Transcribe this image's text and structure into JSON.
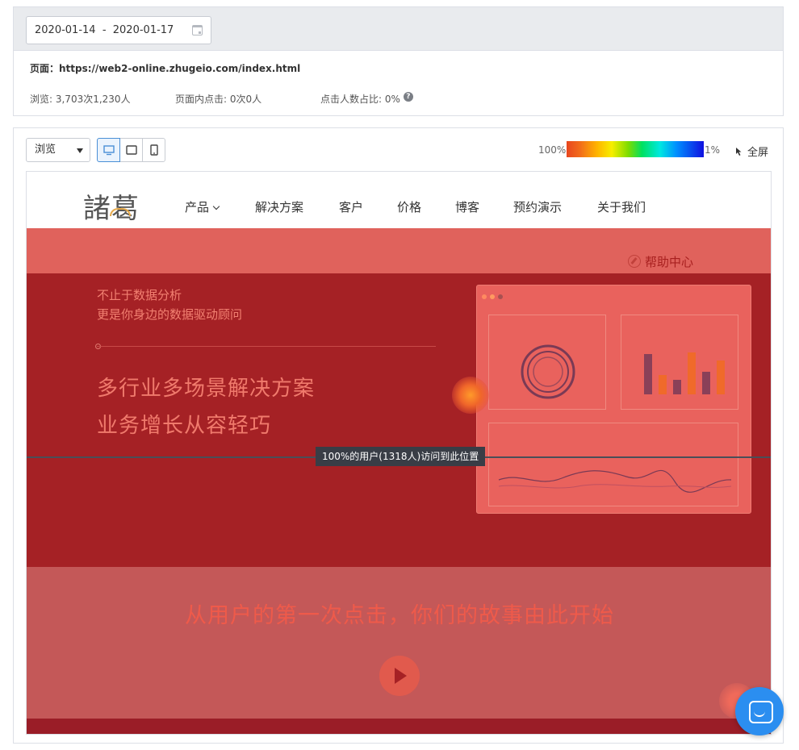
{
  "filter": {
    "date_range": "2020-01-14  -  2020-01-17",
    "page_label": "页面：https://web2-online.zhugeio.com/index.html",
    "stats": {
      "views": "浏览: 3,703次1,230人",
      "in_page_clicks": "页面内点击: 0次0人",
      "click_ratio": "点击人数占比: 0%"
    }
  },
  "toolbar": {
    "mode": "浏览",
    "scale_high": "100%",
    "scale_low": "1%",
    "fullscreen": "全屏",
    "gradient_colors": [
      "#e8461f",
      "#ffb300",
      "#f7ee00",
      "#00e060",
      "#00e8e0",
      "#1010e0"
    ]
  },
  "site": {
    "logo": "諸葛",
    "nav": [
      "产品",
      "解决方案",
      "客户",
      "价格",
      "博客",
      "预约演示",
      "关于我们"
    ],
    "help_center": "帮助中心",
    "hero_sub1": "不止于数据分析",
    "hero_sub2": "更是你身边的数据驱动顾问",
    "hero_title1": "多行业多场景解决方案",
    "hero_title2": "业务增长从容轻巧",
    "scroll_tip": "100%的用户(1318人)访问到此位置",
    "slogan": "从用户的第一次点击，你们的故事由此开始"
  }
}
